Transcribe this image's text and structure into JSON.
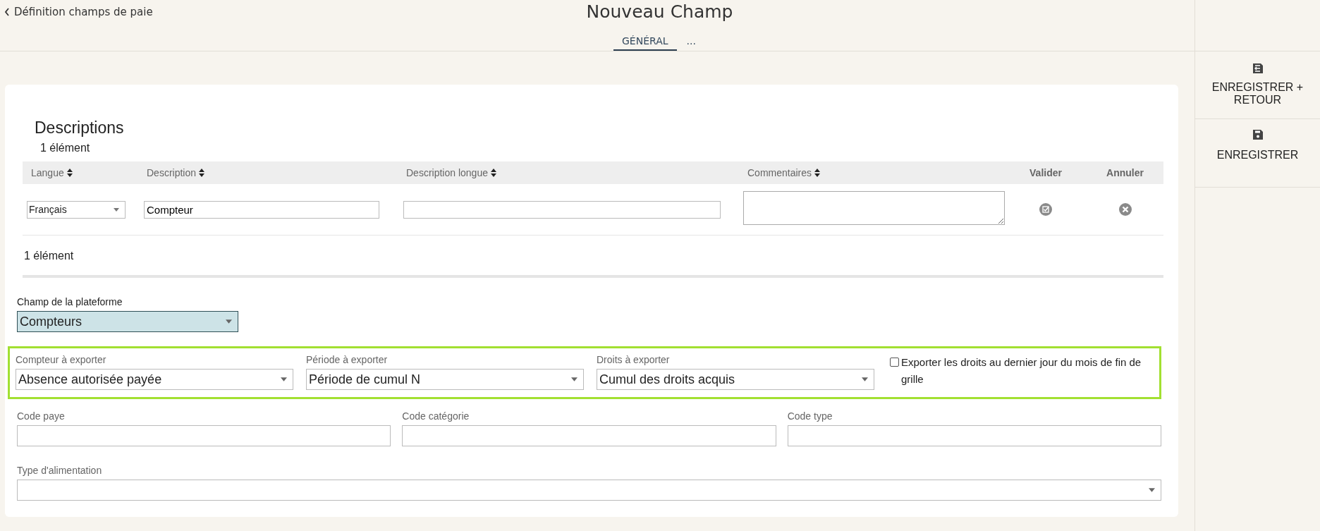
{
  "header": {
    "back_link": "Définition champs de paie",
    "title": "Nouveau Champ"
  },
  "tabs": [
    {
      "label": "GÉNÉRAL",
      "selected": true
    },
    {
      "label": "...",
      "selected": false
    }
  ],
  "actions": [
    {
      "kind": "save-return",
      "label": "ENREGISTRER + RETOUR"
    },
    {
      "kind": "save",
      "label": "ENREGISTRER"
    }
  ],
  "descriptions": {
    "title": "Descriptions",
    "count_top": "1 élément",
    "columns": [
      {
        "label": "Langue",
        "sortable": true
      },
      {
        "label": "Description",
        "sortable": true
      },
      {
        "label": "Description longue",
        "sortable": true
      },
      {
        "label": "Commentaires",
        "sortable": true
      },
      {
        "label": "Valider",
        "sortable": false
      },
      {
        "label": "Annuler",
        "sortable": false
      }
    ],
    "rows": [
      {
        "langue": "Français",
        "description": "Compteur"
      }
    ],
    "count_bottom": "1 élément"
  },
  "platform_field": {
    "label": "Champ de la plateforme",
    "value": "Compteurs"
  },
  "export_group": {
    "selects": [
      {
        "label": "Compteur à exporter",
        "value": "Absence autorisée payée"
      },
      {
        "label": "Période à exporter",
        "value": "Période de cumul N"
      },
      {
        "label": "Droits à exporter",
        "value": "Cumul des droits acquis"
      }
    ],
    "checkbox": {
      "label": "Exporter les droits au dernier jour du mois de fin de grille",
      "checked": false
    }
  },
  "codes": [
    {
      "label": "Code paye"
    },
    {
      "label": "Code catégorie"
    },
    {
      "label": "Code type"
    }
  ],
  "feed_type": {
    "label": "Type d'alimentation"
  }
}
